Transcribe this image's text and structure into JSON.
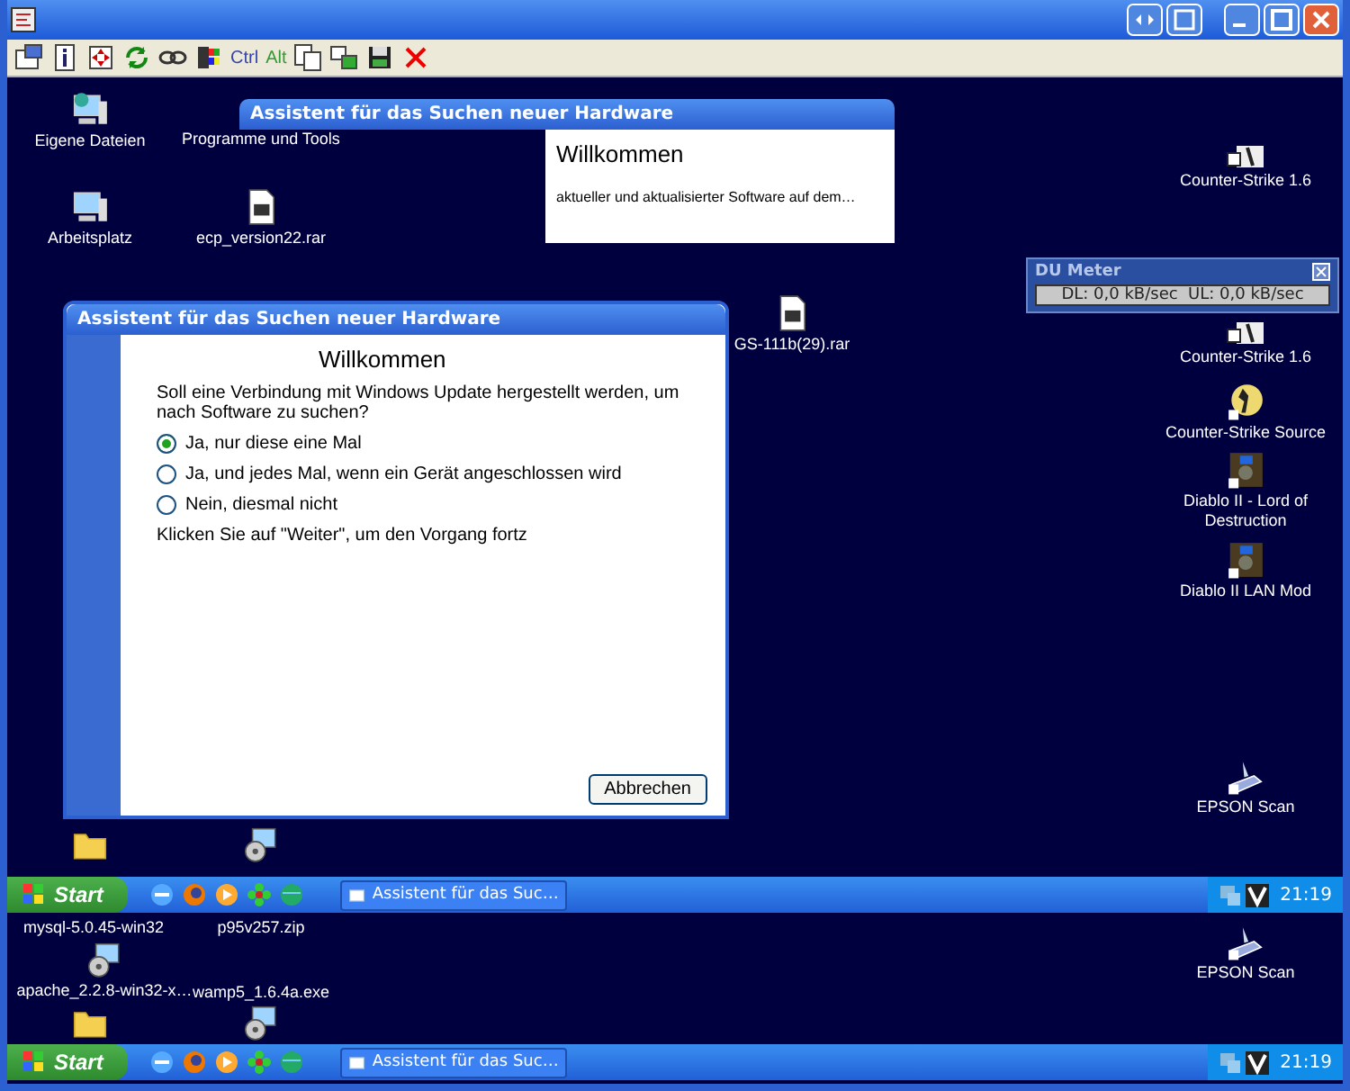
{
  "viewer": {
    "toolbar": [
      {
        "kind": "icon"
      },
      {
        "kind": "icon"
      },
      {
        "kind": "icon"
      },
      {
        "kind": "icon"
      },
      {
        "kind": "icon"
      },
      {
        "kind": "icon"
      },
      {
        "kind": "text",
        "label": "Ctrl"
      },
      {
        "kind": "text",
        "label": "Alt"
      },
      {
        "kind": "icon"
      },
      {
        "kind": "icon"
      },
      {
        "kind": "icon"
      },
      {
        "kind": "icon"
      }
    ]
  },
  "desktop_icons": [
    {
      "label": "Eigene Dateien",
      "kind": "documents"
    },
    {
      "label": "Programme und Tools",
      "kind": "none"
    },
    {
      "label": "Arbeitsplatz",
      "kind": "computer"
    },
    {
      "label": "ecp_version22.rar",
      "kind": "rar"
    },
    {
      "label": "GS-111b(29).rar",
      "kind": "rar"
    },
    {
      "label": "Counter-Strike 1.6",
      "kind": "game"
    },
    {
      "label": "Counter-Strike 1.6",
      "kind": "game"
    },
    {
      "label": "Counter-Strike Source",
      "kind": "cs"
    },
    {
      "label": "Diablo II - Lord of Destruction",
      "kind": "diablo"
    },
    {
      "label": "Diablo II LAN Mod",
      "kind": "diablo"
    },
    {
      "label": "EPSON Scan",
      "kind": "scanner"
    },
    {
      "label": "EPSON Scan",
      "kind": "scanner"
    },
    {
      "kind": "folder"
    },
    {
      "kind": "installer"
    },
    {
      "label": "mysql-5.0.45-win32",
      "kind": "none"
    },
    {
      "label": "p95v257.zip",
      "kind": "none"
    },
    {
      "label": "apache_2.2.8-win32-x…",
      "kind": "installer"
    },
    {
      "label": "wamp5_1.6.4a.exe",
      "kind": "none"
    },
    {
      "kind": "folder"
    },
    {
      "kind": "installer"
    }
  ],
  "wizard_back": {
    "title": "Assistent für das Suchen neuer Hardware",
    "heading": "Willkommen",
    "text": "aktueller und aktualisierter Software auf dem…"
  },
  "wizard_front": {
    "title": "Assistent für das Suchen neuer Hardware",
    "heading": "Willkommen",
    "question": "Soll eine Verbindung mit Windows Update hergestellt werden, um nach Software zu suchen?",
    "options": [
      {
        "label": "Ja, nur diese eine Mal",
        "selected": true
      },
      {
        "label": "Ja, und jedes Mal, wenn ein Gerät angeschlossen wird",
        "selected": false
      },
      {
        "label": "Nein, diesmal nicht",
        "selected": false
      }
    ],
    "hint": "Klicken Sie auf \"Weiter\", um den Vorgang fortz",
    "button": "Abbrechen"
  },
  "du_meter": {
    "title": "DU Meter",
    "reading": "DL: 0,0 kB/sec  UL: 0,0 kB/sec"
  },
  "taskbars": [
    {
      "start": "Start",
      "task": "Assistent für das Suc…",
      "clock": "21:19"
    },
    {
      "start": "Start",
      "task": "Assistent für das Suc…",
      "clock": "21:19"
    }
  ]
}
